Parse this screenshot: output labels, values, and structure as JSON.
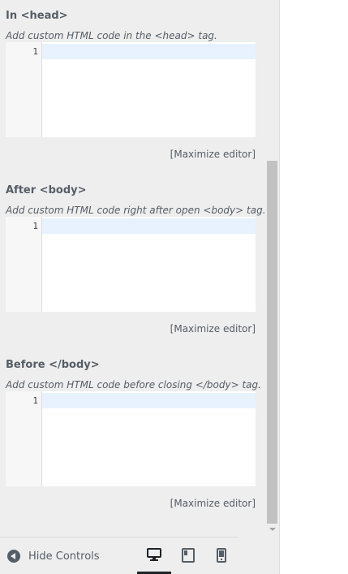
{
  "sections": [
    {
      "title": "In <head>",
      "description": "Add custom HTML code in the <head> tag.",
      "line_number": "1",
      "maximize_label": "[Maximize editor]"
    },
    {
      "title": "After <body>",
      "description": "Add custom HTML code right after open <body> tag.",
      "line_number": "1",
      "maximize_label": "[Maximize editor]"
    },
    {
      "title": "Before </body>",
      "description": "Add custom HTML code before closing </body> tag.",
      "line_number": "1",
      "maximize_label": "[Maximize editor]"
    }
  ],
  "footer": {
    "hide_controls_label": "Hide Controls",
    "hide_controls_icon": "arrow-left-circle-icon",
    "devices": [
      {
        "icon": "desktop-icon",
        "active": true
      },
      {
        "icon": "tablet-icon",
        "active": false
      },
      {
        "icon": "mobile-icon",
        "active": false
      }
    ]
  },
  "colors": {
    "panel_bg": "#eeeeee",
    "text": "#555d66",
    "active_line": "#e8f2fe",
    "scrollbar_thumb": "#c1c1c1"
  }
}
